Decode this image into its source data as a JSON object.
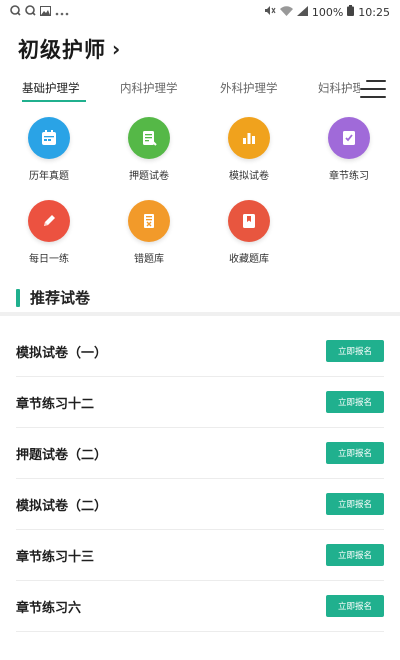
{
  "status_bar": {
    "left_icons": [
      "q-app-icon",
      "q-app-icon",
      "image-icon",
      "more-dots-icon"
    ],
    "battery": "100%",
    "time": "10:25"
  },
  "header": {
    "title": "初级护师",
    "chevron": "›"
  },
  "tabs": [
    {
      "label": "基础护理学",
      "active": true
    },
    {
      "label": "内科护理学",
      "active": false
    },
    {
      "label": "外科护理学",
      "active": false
    },
    {
      "label": "妇科护理学",
      "active": false
    }
  ],
  "categories": [
    {
      "label": "历年真题",
      "icon": "calendar-icon",
      "color": "#2aa3e6"
    },
    {
      "label": "押题试卷",
      "icon": "document-icon",
      "color": "#55b847"
    },
    {
      "label": "模拟试卷",
      "icon": "bar-chart-icon",
      "color": "#f0a21d"
    },
    {
      "label": "章节练习",
      "icon": "checklist-icon",
      "color": "#a06ad9"
    },
    {
      "label": "每日一练",
      "icon": "pencil-icon",
      "color": "#ec5240"
    },
    {
      "label": "错题库",
      "icon": "error-book-icon",
      "color": "#f29a2a"
    },
    {
      "label": "收藏题库",
      "icon": "bookmark-icon",
      "color": "#e8563f"
    }
  ],
  "section": {
    "title": "推荐试卷"
  },
  "papers": [
    {
      "name": "模拟试卷（一）",
      "button": "立即报名"
    },
    {
      "name": "章节练习十二",
      "button": "立即报名"
    },
    {
      "name": "押题试卷（二）",
      "button": "立即报名"
    },
    {
      "name": "模拟试卷（二）",
      "button": "立即报名"
    },
    {
      "name": "章节练习十三",
      "button": "立即报名"
    },
    {
      "name": "章节练习六",
      "button": "立即报名"
    }
  ],
  "colors": {
    "accent": "#20b08e"
  }
}
